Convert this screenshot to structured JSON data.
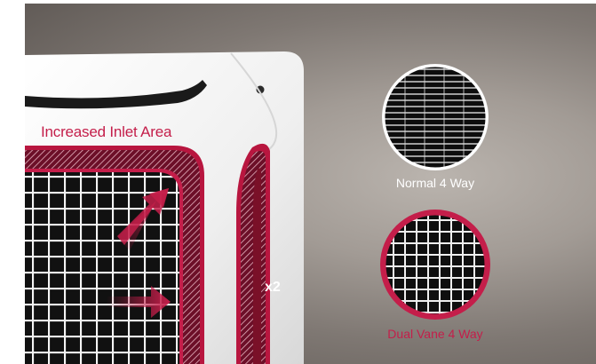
{
  "labels": {
    "increased_inlet_area": "Increased Inlet Area",
    "multiplier": "x2",
    "normal_4_way": "Normal 4 Way",
    "dual_vane_4_way": "Dual Vane 4 Way"
  },
  "colors": {
    "accent": "#c41e4a",
    "background": "#8a837e",
    "panel": "#f2f2f2",
    "grille": "#141414"
  },
  "icons": [
    "arrow-diagonal-icon",
    "arrow-right-icon"
  ]
}
